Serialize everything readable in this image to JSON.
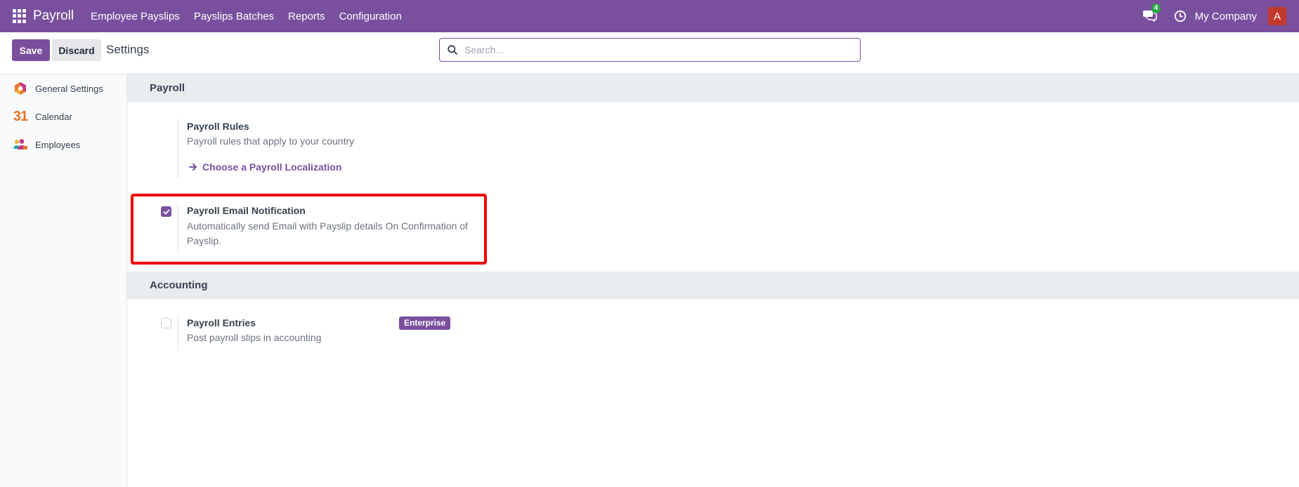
{
  "navbar": {
    "brand": "Payroll",
    "menu": [
      "Employee Payslips",
      "Payslips Batches",
      "Reports",
      "Configuration"
    ],
    "chat_badge": "4",
    "company": "My Company",
    "avatar_initial": "A",
    "colors": {
      "primary": "#7a4f9e",
      "avatar": "#c0392b",
      "badge": "#28a745"
    }
  },
  "control": {
    "save_label": "Save",
    "discard_label": "Discard",
    "title": "Settings",
    "search_placeholder": "Search..."
  },
  "sidebar": {
    "items": [
      {
        "label": "General Settings",
        "icon": "odoo-settings-icon"
      },
      {
        "label": "Calendar",
        "icon": "calendar-icon",
        "icon_text": "31"
      },
      {
        "label": "Employees",
        "icon": "employees-icon"
      }
    ]
  },
  "sections": {
    "payroll": {
      "header": "Payroll",
      "rules_title": "Payroll Rules",
      "rules_desc": "Payroll rules that apply to your country",
      "rules_link": "Choose a Payroll Localization",
      "email_title": "Payroll Email Notification",
      "email_desc": "Automatically send Email with Payslip details On Confirmation of Payslip.",
      "email_checked": true
    },
    "accounting": {
      "header": "Accounting",
      "entries_title": "Payroll Entries",
      "entries_desc": "Post payroll slips in accounting",
      "entries_badge": "Enterprise",
      "entries_checked": false
    }
  },
  "annotation": {
    "highlight_color": "#f00000"
  }
}
